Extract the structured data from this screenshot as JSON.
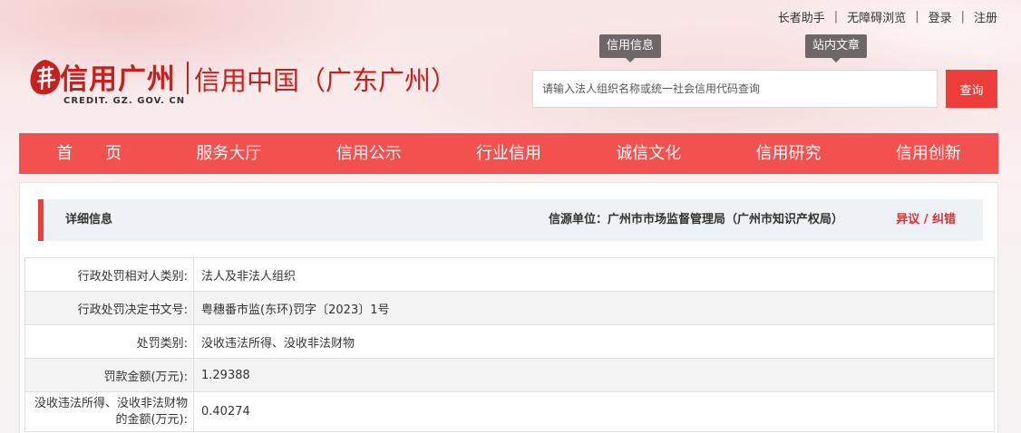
{
  "top_links": [
    "长者助手",
    "无障碍浏览",
    "登录",
    "注册"
  ],
  "top_link_separator": "|",
  "logo": {
    "name_cn": "信用广州",
    "name_en": "CREDIT. GZ. GOV. CN",
    "subtitle": "信用中国（广东广州）",
    "brand_color": "#c8201e"
  },
  "search": {
    "tabs": [
      "信用信息",
      "站内文章"
    ],
    "placeholder": "请输入法人组织名称或统一社会信用代码查询",
    "button": "查询"
  },
  "nav": {
    "items": [
      "首　　页",
      "服务大厅",
      "信用公示",
      "行业信用",
      "诚信文化",
      "信用研究",
      "信用创新"
    ],
    "color": "#f25150"
  },
  "detail": {
    "title": "详细信息",
    "source": "信源单位：广州市市场监督管理局（广州市知识产权局）",
    "objection": "异议 / 纠错"
  },
  "rows": [
    {
      "label": "行政处罚相对人类别:",
      "value": "法人及非法人组织"
    },
    {
      "label": "行政处罚决定书文号:",
      "value": "粤穗番市监(东环)罚字〔2023〕1号"
    },
    {
      "label": "处罚类别:",
      "value": "没收违法所得、没收非法财物"
    },
    {
      "label": "罚款金额(万元):",
      "value": "1.29388"
    },
    {
      "label": "没收违法所得、没收非法财物的金额(万元):",
      "value": "0.40274"
    }
  ]
}
